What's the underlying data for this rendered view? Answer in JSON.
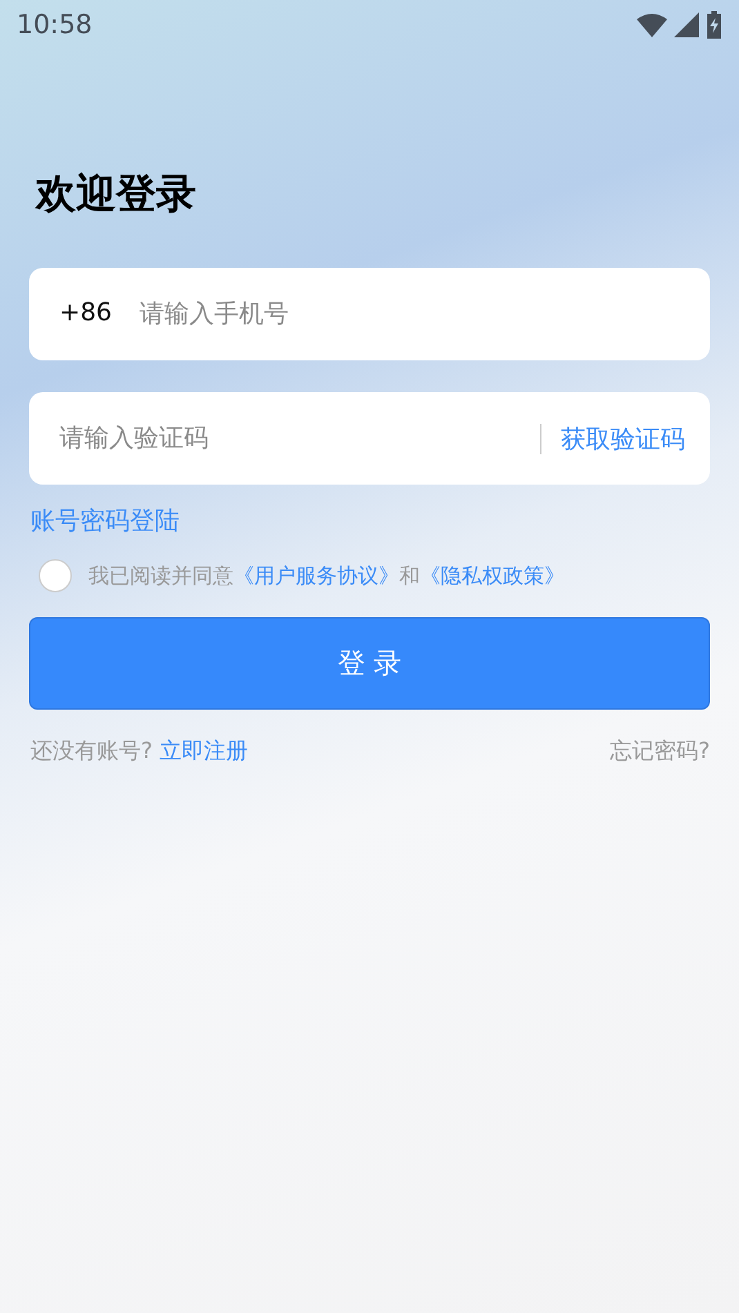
{
  "status_bar": {
    "time": "10:58"
  },
  "title": "欢迎登录",
  "phone_field": {
    "prefix": "+86",
    "placeholder": "请输入手机号"
  },
  "code_field": {
    "placeholder": "请输入验证码",
    "action": "获取验证码"
  },
  "password_login_link": "账号密码登陆",
  "agreement": {
    "checked": false,
    "text": "我已阅读并同意",
    "terms_link": "《用户服务协议》",
    "conjunction": "和",
    "privacy_link": "《隐私权政策》"
  },
  "login_button": "登 录",
  "footer": {
    "prompt": "还没有账号?",
    "register_link": "立即注册",
    "forgot_link": "忘记密码?"
  }
}
